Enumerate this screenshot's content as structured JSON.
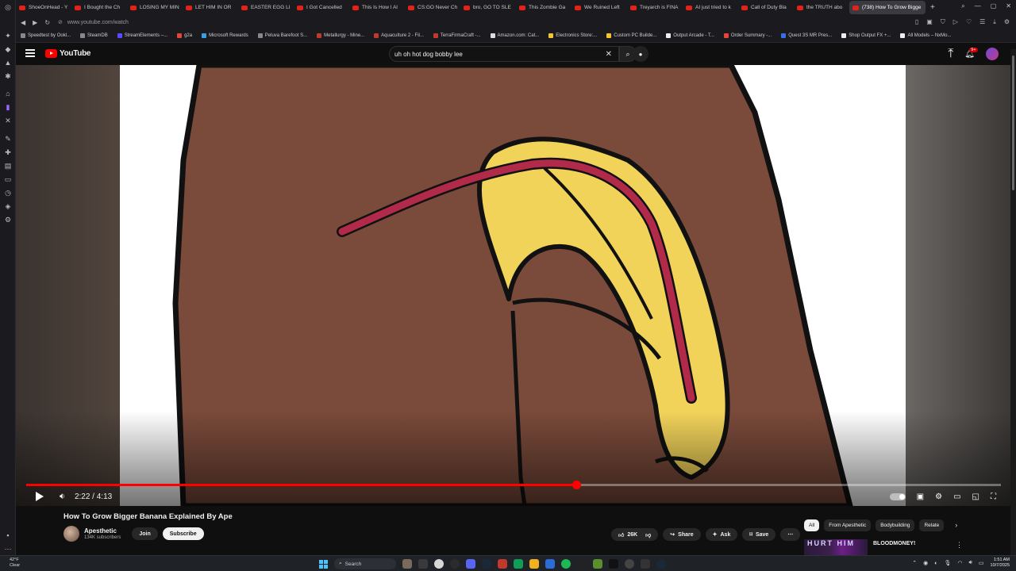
{
  "browser": {
    "tabs": [
      {
        "label": "ShoeOnHead - Y"
      },
      {
        "label": "I Bought the Ch"
      },
      {
        "label": "LOSING MY MIN"
      },
      {
        "label": "LET HIM IN OR"
      },
      {
        "label": "EASTER EGG LI"
      },
      {
        "label": "I Got Cancelled"
      },
      {
        "label": "This Is How I Al"
      },
      {
        "label": "CS:GO Never Ch"
      },
      {
        "label": "bro, GO TO SLE"
      },
      {
        "label": "This Zombie Ga"
      },
      {
        "label": "We Ruined Left"
      },
      {
        "label": "Treyarch is FINA"
      },
      {
        "label": "AI just tried to k"
      },
      {
        "label": "Call of Duty Bla"
      },
      {
        "label": "the TRUTH abo"
      },
      {
        "label": "(738) How To Grow Bigge"
      }
    ],
    "url": "www.youtube.com/watch",
    "bookmarks": [
      {
        "label": "Speedtest by Ookl..."
      },
      {
        "label": "SteamDB"
      },
      {
        "label": "StreamElements –..."
      },
      {
        "label": "g2a"
      },
      {
        "label": "Microsoft Rewards"
      },
      {
        "label": "Peluva Barefoot S..."
      },
      {
        "label": "Metallurgy - Mine..."
      },
      {
        "label": "Aquaculture 2 - Fil..."
      },
      {
        "label": "TerraFirmaCraft -..."
      },
      {
        "label": "Amazon.com: Cat..."
      },
      {
        "label": "Electronics Store:..."
      },
      {
        "label": "Custom PC Builde..."
      },
      {
        "label": "Output Arcade - T..."
      },
      {
        "label": "Order Summary -..."
      },
      {
        "label": "Quest 3S MR Pres..."
      },
      {
        "label": "Shop Output FX +..."
      },
      {
        "label": "All Models – NxMo..."
      }
    ]
  },
  "youtube": {
    "logo": "YouTube",
    "search_value": "uh oh hot dog bobby lee",
    "notifications": "9+",
    "player": {
      "progress": 0.565,
      "time": "2:22 / 4:13"
    },
    "video": {
      "title": "How To Grow Bigger Banana Explained By Ape",
      "channel": "Apesthetic",
      "subscribers": "134K subscribers",
      "join": "Join",
      "subscribe": "Subscribe",
      "likes": "26K",
      "share": "Share",
      "ask": "Ask",
      "save": "Save"
    },
    "chips": [
      "All",
      "From Apesthetic",
      "Bodybuilding",
      "Relate"
    ],
    "recommendation": {
      "thumb_text": "HURT HIM",
      "title": "BLOODMONEY!"
    }
  },
  "taskbar": {
    "temp": "42°F",
    "condition": "Clear",
    "search": "Search",
    "time": "1:51 AM",
    "date": "10/7/2025"
  },
  "colors": {
    "accent": "#ff0000",
    "banana": "#f2d35a",
    "skin": "#7a4a3a"
  }
}
